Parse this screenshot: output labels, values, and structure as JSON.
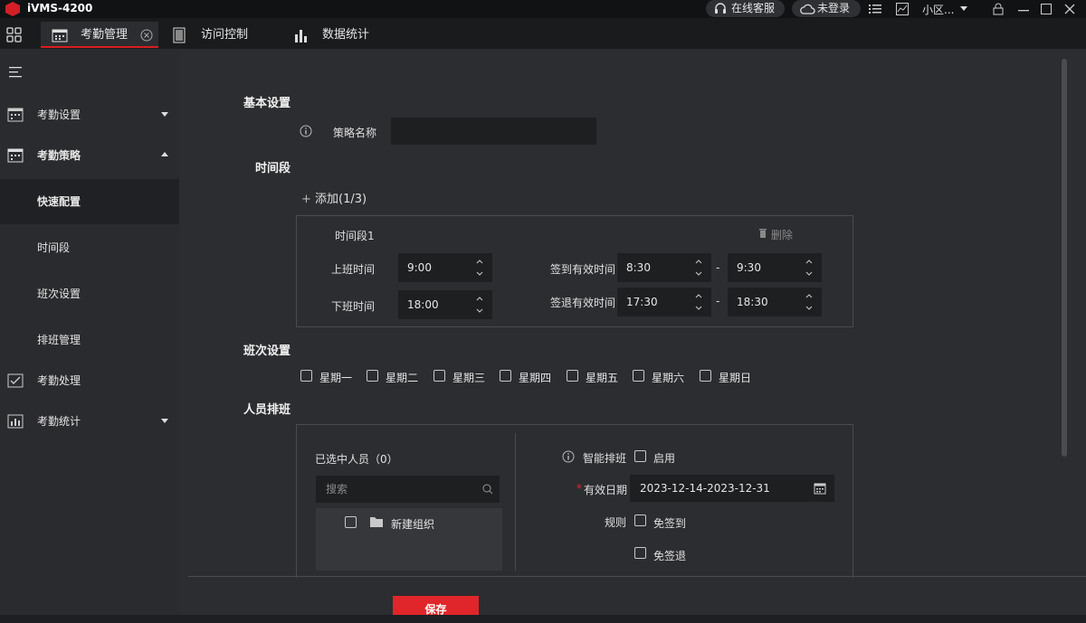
{
  "app": {
    "title": "iVMS-4200"
  },
  "titlebar": {
    "support_label": "在线客服",
    "login_label": "未登录",
    "user_label": "小区..."
  },
  "tabs": [
    {
      "label": "考勤管理"
    },
    {
      "label": "访问控制"
    },
    {
      "label": "数据统计"
    }
  ],
  "sidebar": {
    "items": [
      {
        "label": "考勤设置"
      },
      {
        "label": "考勤策略"
      },
      {
        "label": "快速配置"
      },
      {
        "label": "时间段"
      },
      {
        "label": "班次设置"
      },
      {
        "label": "排班管理"
      },
      {
        "label": "考勤处理"
      },
      {
        "label": "考勤统计"
      }
    ]
  },
  "basic": {
    "title": "基本设置",
    "policy_label": "策略名称",
    "policy_value": ""
  },
  "period": {
    "title": "时间段",
    "add_label": "添加(1/3)",
    "slot_title": "时间段1",
    "delete_label": "删除",
    "work_start_label": "上班时间",
    "work_start": "9:00",
    "work_end_label": "下班时间",
    "work_end": "18:00",
    "checkin_label": "签到有效时间",
    "checkin_from": "8:30",
    "checkin_to": "9:30",
    "checkout_label": "签退有效时间",
    "checkout_from": "17:30",
    "checkout_to": "18:30",
    "dash": "-"
  },
  "shift": {
    "title": "班次设置",
    "days": [
      "星期一",
      "星期二",
      "星期三",
      "星期四",
      "星期五",
      "星期六",
      "星期日"
    ]
  },
  "people": {
    "title": "人员排班",
    "selected_label": "已选中人员（0）",
    "search_placeholder": "搜索",
    "org_label": "新建组织",
    "smart_label": "智能排班",
    "enable_label": "启用",
    "date_label": "有效日期",
    "date_required": "*",
    "date_value": "2023-12-14-2023-12-31",
    "rule_label": "规则",
    "no_checkin_label": "免签到",
    "no_checkout_label": "免签退"
  },
  "footer": {
    "save_label": "保存"
  },
  "colors": {
    "accent": "#e0262b",
    "sidebar": "#2a2b2e",
    "main": "#2c2d30",
    "input": "#1e1f21"
  }
}
